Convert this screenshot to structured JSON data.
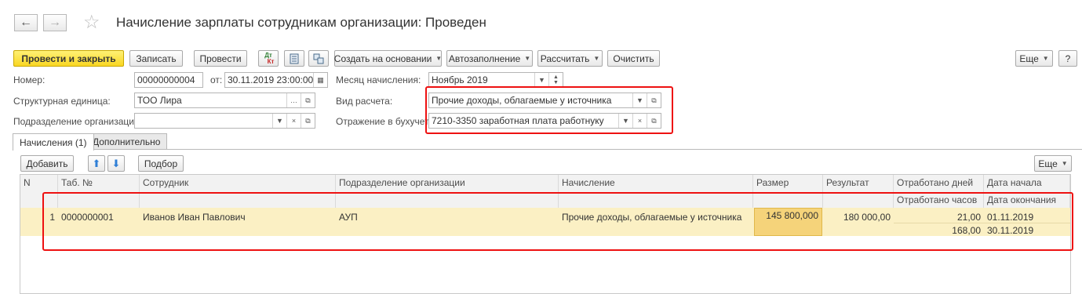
{
  "window": {
    "title": "Начисление зарплаты сотрудникам организации: Проведен"
  },
  "toolbar": {
    "post_close": "Провести и закрыть",
    "save": "Записать",
    "post": "Провести",
    "dtkt_top": "Дт",
    "dtkt_bottom": "Кт",
    "create_based": "Создать на основании",
    "autofill": "Автозаполнение",
    "calculate": "Рассчитать",
    "clear": "Очистить",
    "more": "Еще",
    "help": "?"
  },
  "form": {
    "number_label": "Номер:",
    "number_value": "00000000004",
    "date_label": "от:",
    "date_value": "30.11.2019 23:00:00",
    "month_label": "Месяц начисления:",
    "month_value": "Ноябрь 2019",
    "unit_label": "Структурная единица:",
    "unit_value": "ТОО Лира",
    "calc_type_label": "Вид расчета:",
    "calc_type_value": "Прочие доходы, облагаемые у источника",
    "department_label": "Подразделение организации:",
    "department_value": "",
    "accounting_label": "Отражение в бухучете:",
    "accounting_value": "7210-3350 заработная плата работнуку"
  },
  "tabs": [
    {
      "label": "Начисления (1)"
    },
    {
      "label": "Дополнительно"
    }
  ],
  "table_toolbar": {
    "add": "Добавить",
    "select": "Подбор",
    "more": "Еще"
  },
  "table": {
    "headers": {
      "n": "N",
      "tab_no": "Таб. №",
      "employee": "Сотрудник",
      "department": "Подразделение организации",
      "accrual": "Начисление",
      "amount": "Размер",
      "result": "Результат",
      "days": "Отработано дней",
      "hours": "Отработано часов",
      "start": "Дата начала",
      "end": "Дата окончания"
    },
    "rows": [
      {
        "n": "1",
        "tab_no": "0000000001",
        "employee": "Иванов Иван Павлович",
        "department": "АУП",
        "accrual": "Прочие доходы, облагаемые у источника",
        "amount": "145 800,000",
        "result": "180 000,00",
        "days": "21,00",
        "hours": "168,00",
        "start": "01.11.2019",
        "end": "30.11.2019"
      }
    ]
  },
  "colors": {
    "highlight_box": "#ee1111",
    "primary_button": "#f9d622",
    "row_background": "#fbf0c4",
    "selected_cell": "#f5d37a"
  }
}
